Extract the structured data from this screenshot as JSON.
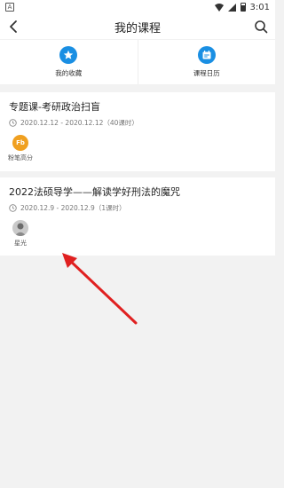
{
  "status_bar": {
    "time": "3:01",
    "notif_glyph": "A"
  },
  "header": {
    "title": "我的课程"
  },
  "quick_links": [
    {
      "label": "我的收藏",
      "icon": "star-icon"
    },
    {
      "label": "课程日历",
      "icon": "calendar-icon"
    }
  ],
  "courses": [
    {
      "title": "专题课-考研政治扫盲",
      "dates": "2020.12.12 - 2020.12.12（40课时）",
      "teacher": {
        "name": "粉笔高分",
        "avatar": "Fb"
      }
    },
    {
      "title": "2022法硕导学——解读学好刑法的魔咒",
      "dates": "2020.12.9 - 2020.12.9（1课时）",
      "teacher": {
        "name": "星光",
        "avatar": ""
      }
    }
  ],
  "colors": {
    "accent": "#1a8fe3",
    "annotation_arrow": "#e02020",
    "background": "#f2f2f2"
  }
}
